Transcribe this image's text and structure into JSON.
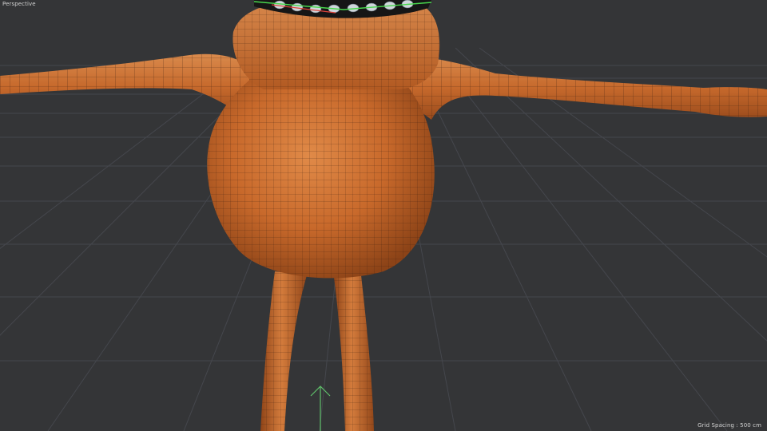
{
  "viewport": {
    "view_name": "Perspective",
    "grid_spacing": "Grid Spacing : 500 cm"
  },
  "colors": {
    "background": "#343537",
    "grid_line": "#44464c",
    "model_base": "#c66a2c",
    "wire": "#3a1f10",
    "y_axis": "#5fbf6a"
  },
  "icons": {
    "axis_gizmo": "y-axis-arrow-icon"
  }
}
